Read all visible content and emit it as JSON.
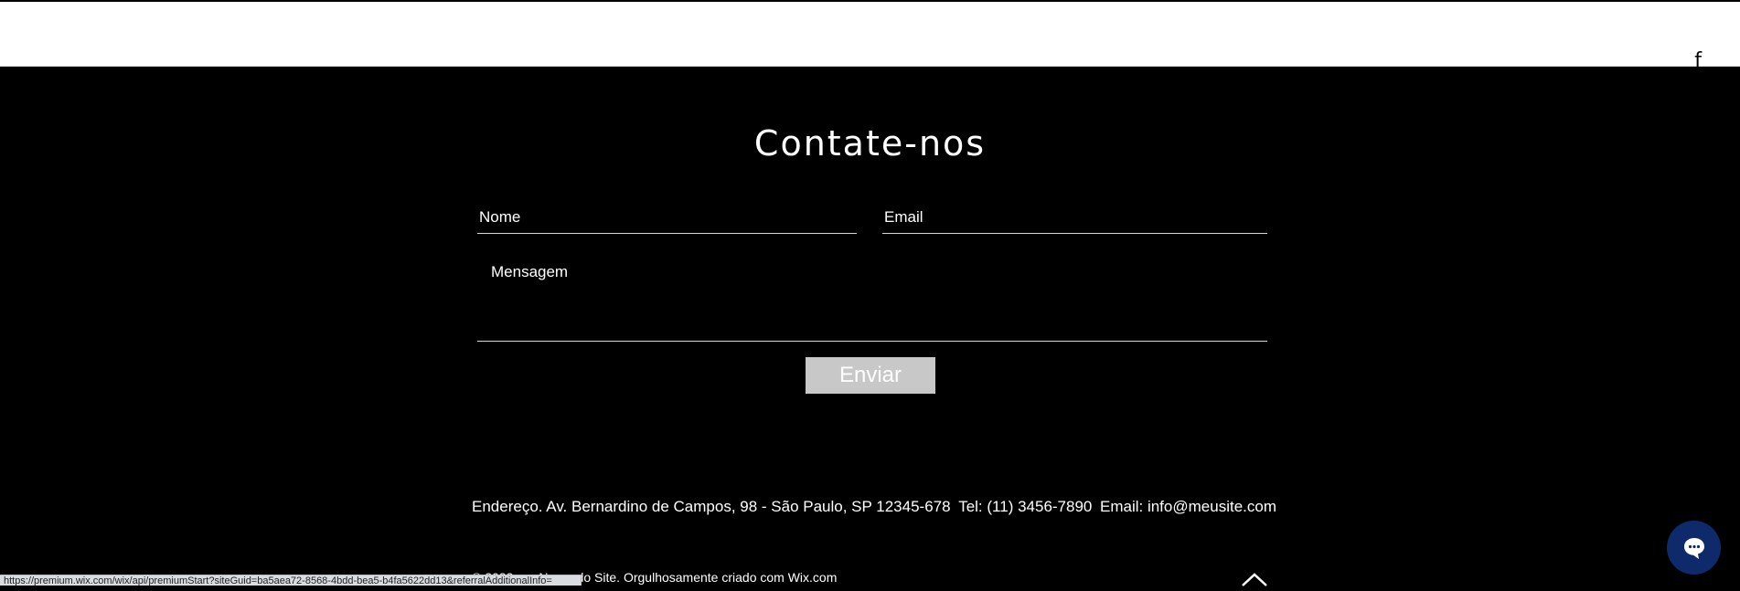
{
  "header": {
    "corner_glyph": "f"
  },
  "contact": {
    "title": "Contate-nos",
    "name_placeholder": "Nome",
    "email_placeholder": "Email",
    "message_placeholder": "Mensagem",
    "send_label": "Enviar"
  },
  "footer": {
    "address": "Endereço. Av. Bernardino de Campos, 98 - São Paulo, SP 12345-678",
    "phone": "Tel: (11) 3456-7890",
    "email": "Email: info@meusite.com",
    "credit": "© 2023 por Nome do Site. Orgulhosamente criado com Wix.com"
  },
  "status_bar": {
    "url": "https://premium.wix.com/wix/api/premiumStart?siteGuid=ba5aea72-8568-4bdd-bea5-b4fa5622dd13&referralAdditionalInfo="
  },
  "icons": {
    "scroll_top": "chevron-up-icon",
    "chat": "chat-bubble-icon"
  },
  "colors": {
    "background": "#000000",
    "button": "#c8c8c8",
    "chat": "#0f2a6b"
  }
}
